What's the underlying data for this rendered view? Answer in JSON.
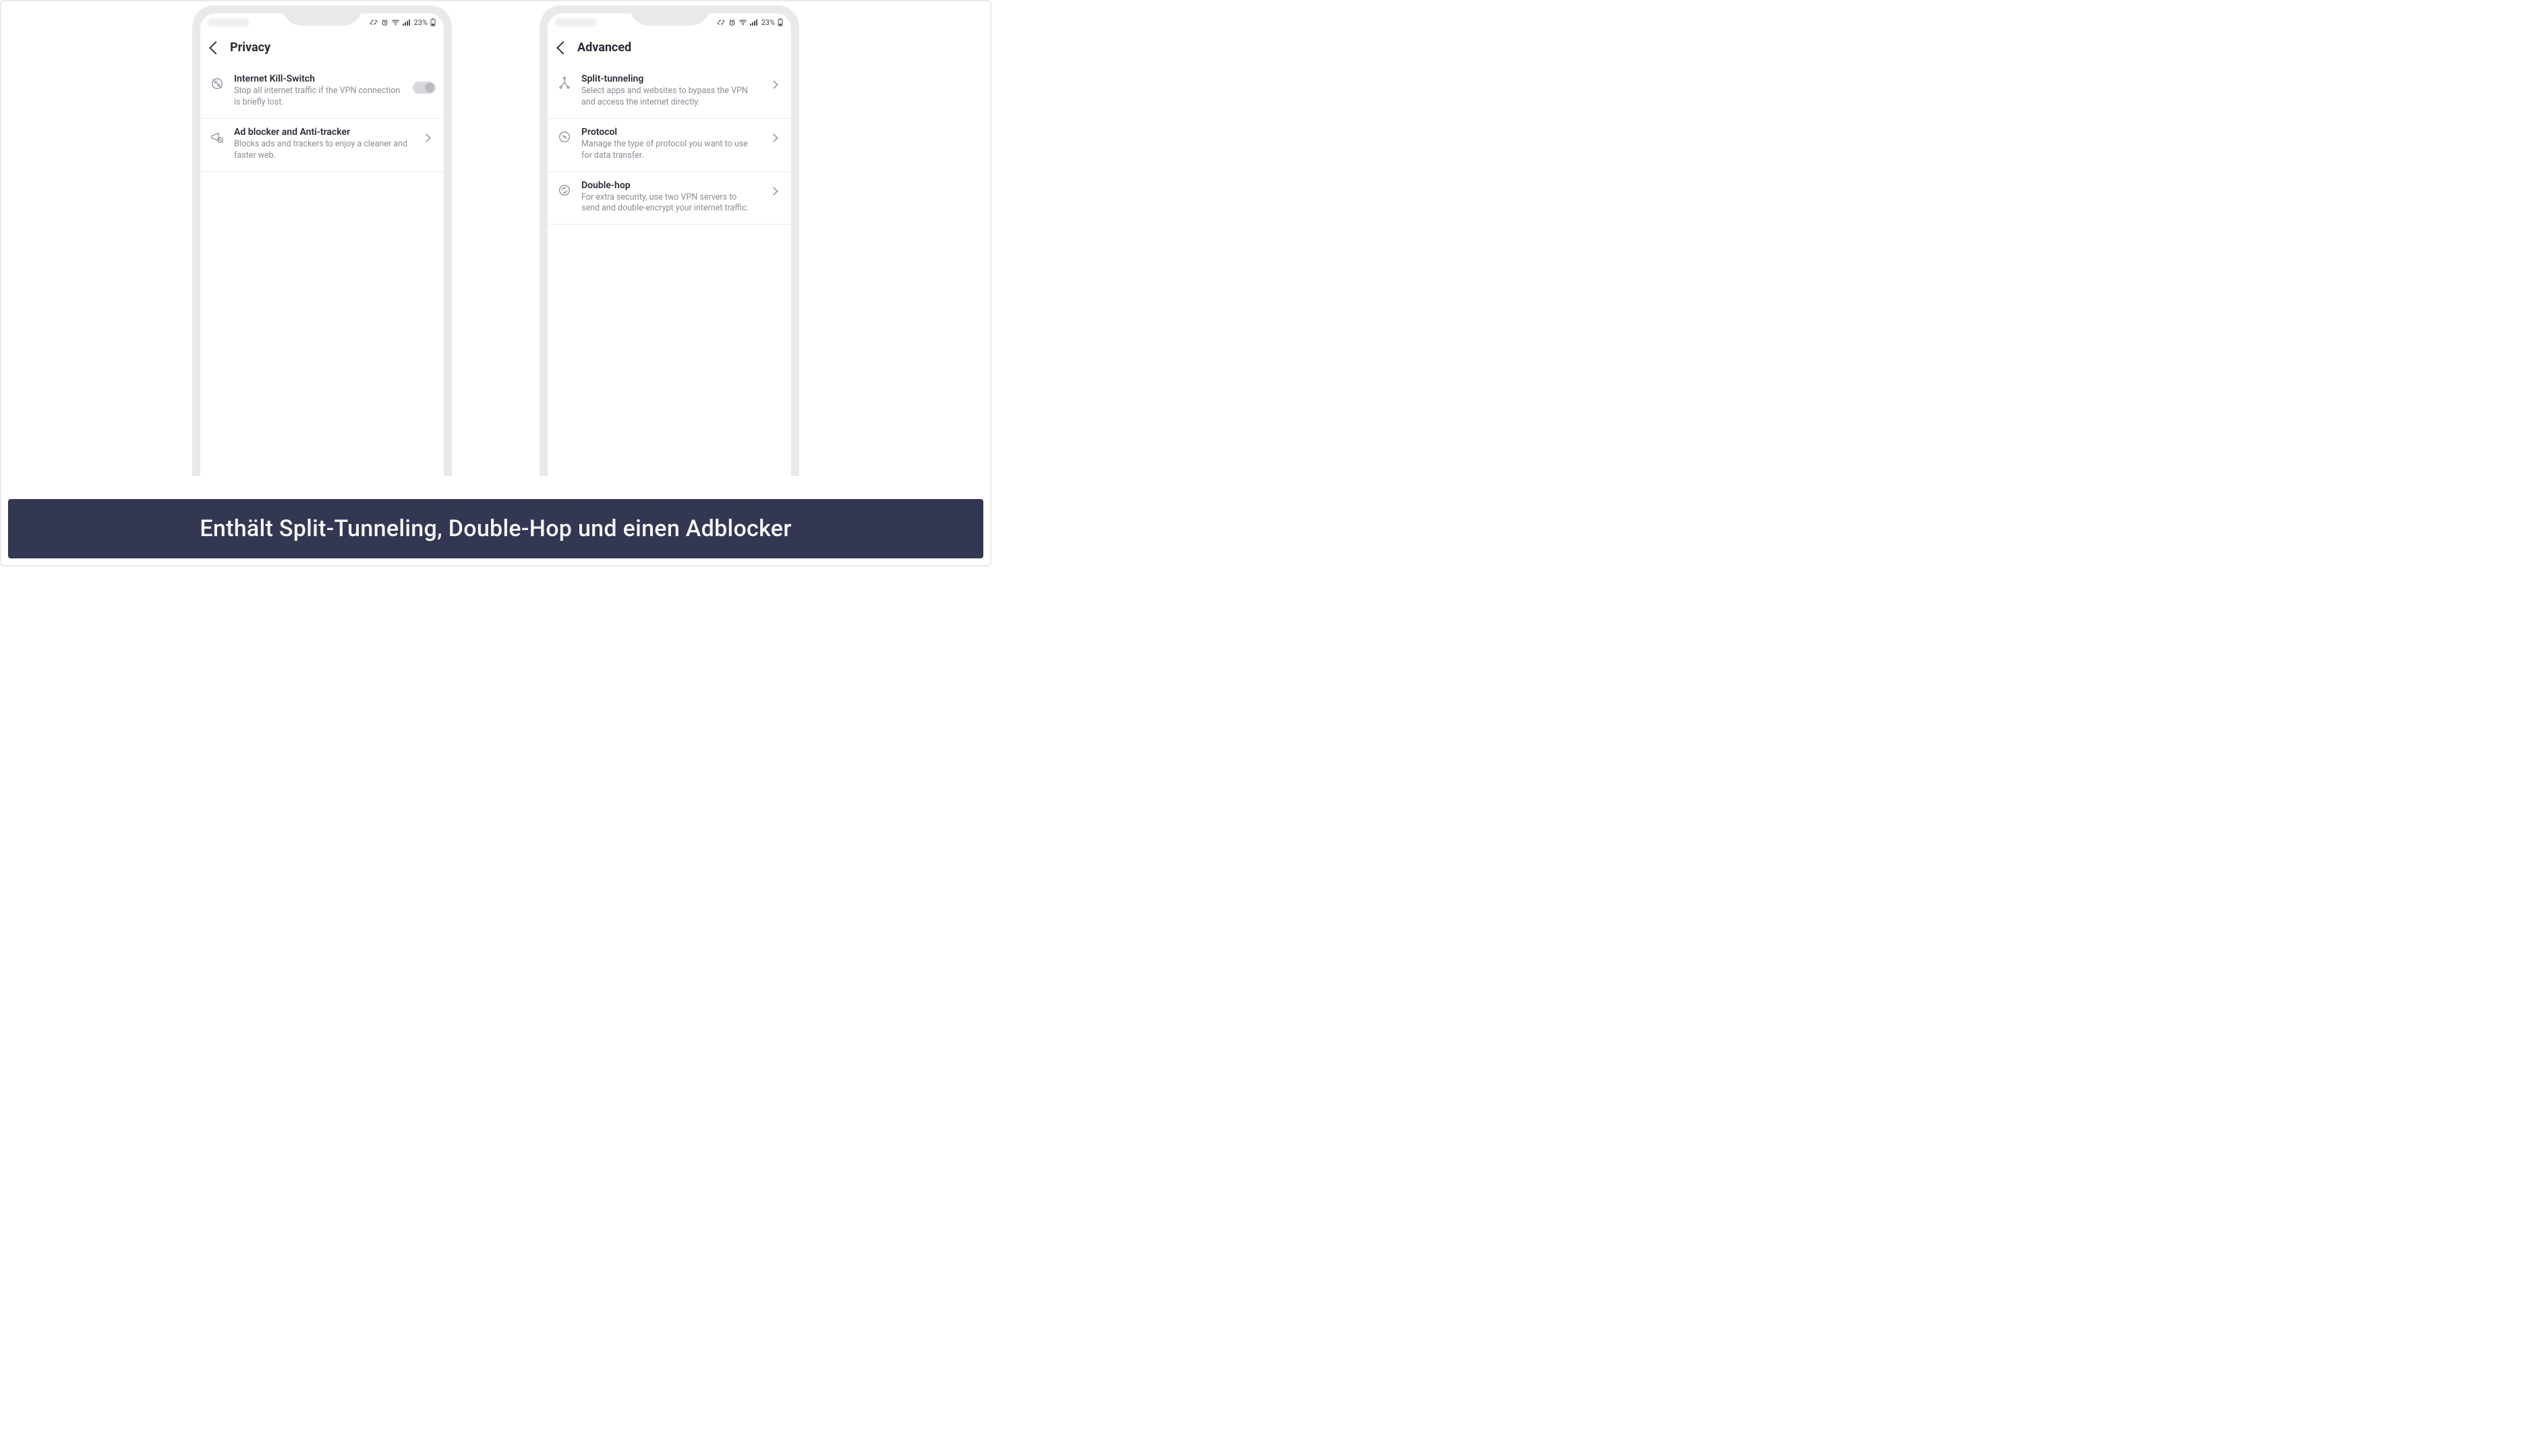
{
  "statusbar": {
    "battery_text": "23%"
  },
  "phone_privacy": {
    "title": "Privacy",
    "items": [
      {
        "title": "Internet Kill-Switch",
        "desc": "Stop all internet traffic if the VPN connection is briefly lost."
      },
      {
        "title": "Ad blocker and Anti-tracker",
        "desc": "Blocks ads and trackers to enjoy a cleaner and faster web."
      }
    ]
  },
  "phone_advanced": {
    "title": "Advanced",
    "items": [
      {
        "title": "Split-tunneling",
        "desc": "Select apps and websites to bypass the VPN and access the internet directly."
      },
      {
        "title": "Protocol",
        "desc": "Manage the type of protocol you want to use for data transfer."
      },
      {
        "title": "Double-hop",
        "desc": "For extra security, use two VPN servers to send and double-encrypt your internet traffic."
      }
    ]
  },
  "caption": "Enthält Split-Tunneling, Double-Hop und einen Adblocker"
}
